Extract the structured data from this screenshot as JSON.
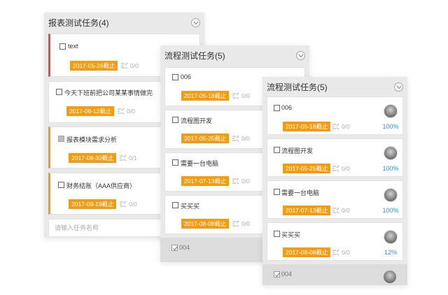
{
  "panels": [
    {
      "title": "报表测试任务(4)",
      "tasks": [
        {
          "title": "text",
          "deadline": "2017-05-26截止",
          "subtasks": "0/0"
        },
        {
          "title": "今天下班前把公司某某事情做完",
          "deadline": "2017-06-12截止",
          "subtasks": "0/0"
        },
        {
          "title": "报表模块需求分析",
          "deadline": "2017-08-30截止",
          "subtasks": "0/1"
        },
        {
          "title": "财务结账（AAA供应商）",
          "deadline": "2017-09-19截止",
          "subtasks": "0/0"
        }
      ],
      "input_placeholder": "请输入任务名称"
    },
    {
      "title": "流程测试任务(5)",
      "tasks": [
        {
          "title": "006",
          "deadline": "2017-05-18截止",
          "subtasks": "0/0"
        },
        {
          "title": "流程图开发",
          "deadline": "2017-05-25截止",
          "subtasks": "0/0"
        },
        {
          "title": "需要一台电脑",
          "deadline": "2017-07-13截止",
          "subtasks": "0/0"
        },
        {
          "title": "买买买",
          "deadline": "2017-08-08截止",
          "subtasks": "0/0"
        }
      ],
      "done_task": "004"
    },
    {
      "title": "流程测试任务(5)",
      "tasks": [
        {
          "title": "006",
          "deadline": "2017-05-18截止",
          "subtasks": "0/0",
          "percent": "100%"
        },
        {
          "title": "流程图开发",
          "deadline": "2017-05-25截止",
          "subtasks": "0/0",
          "percent": "100%"
        },
        {
          "title": "需要一台电脑",
          "deadline": "2017-07-13截止",
          "subtasks": "0/0",
          "percent": "100%"
        },
        {
          "title": "买买买",
          "deadline": "2017-08-08截止",
          "subtasks": "0/0",
          "percent": "12%"
        }
      ],
      "done_task": "004"
    }
  ],
  "colors": {
    "deadline_badge": "#f39c12",
    "accent_red": "#e74c3c",
    "accent_orange": "#f39c12",
    "percent_text": "#2a93d5",
    "panel_bg": "#e9e9e9"
  },
  "icons": {
    "collapse": "chevron-down-circle-icon",
    "subtasks": "subtask-icon",
    "avatar": "avatar"
  }
}
